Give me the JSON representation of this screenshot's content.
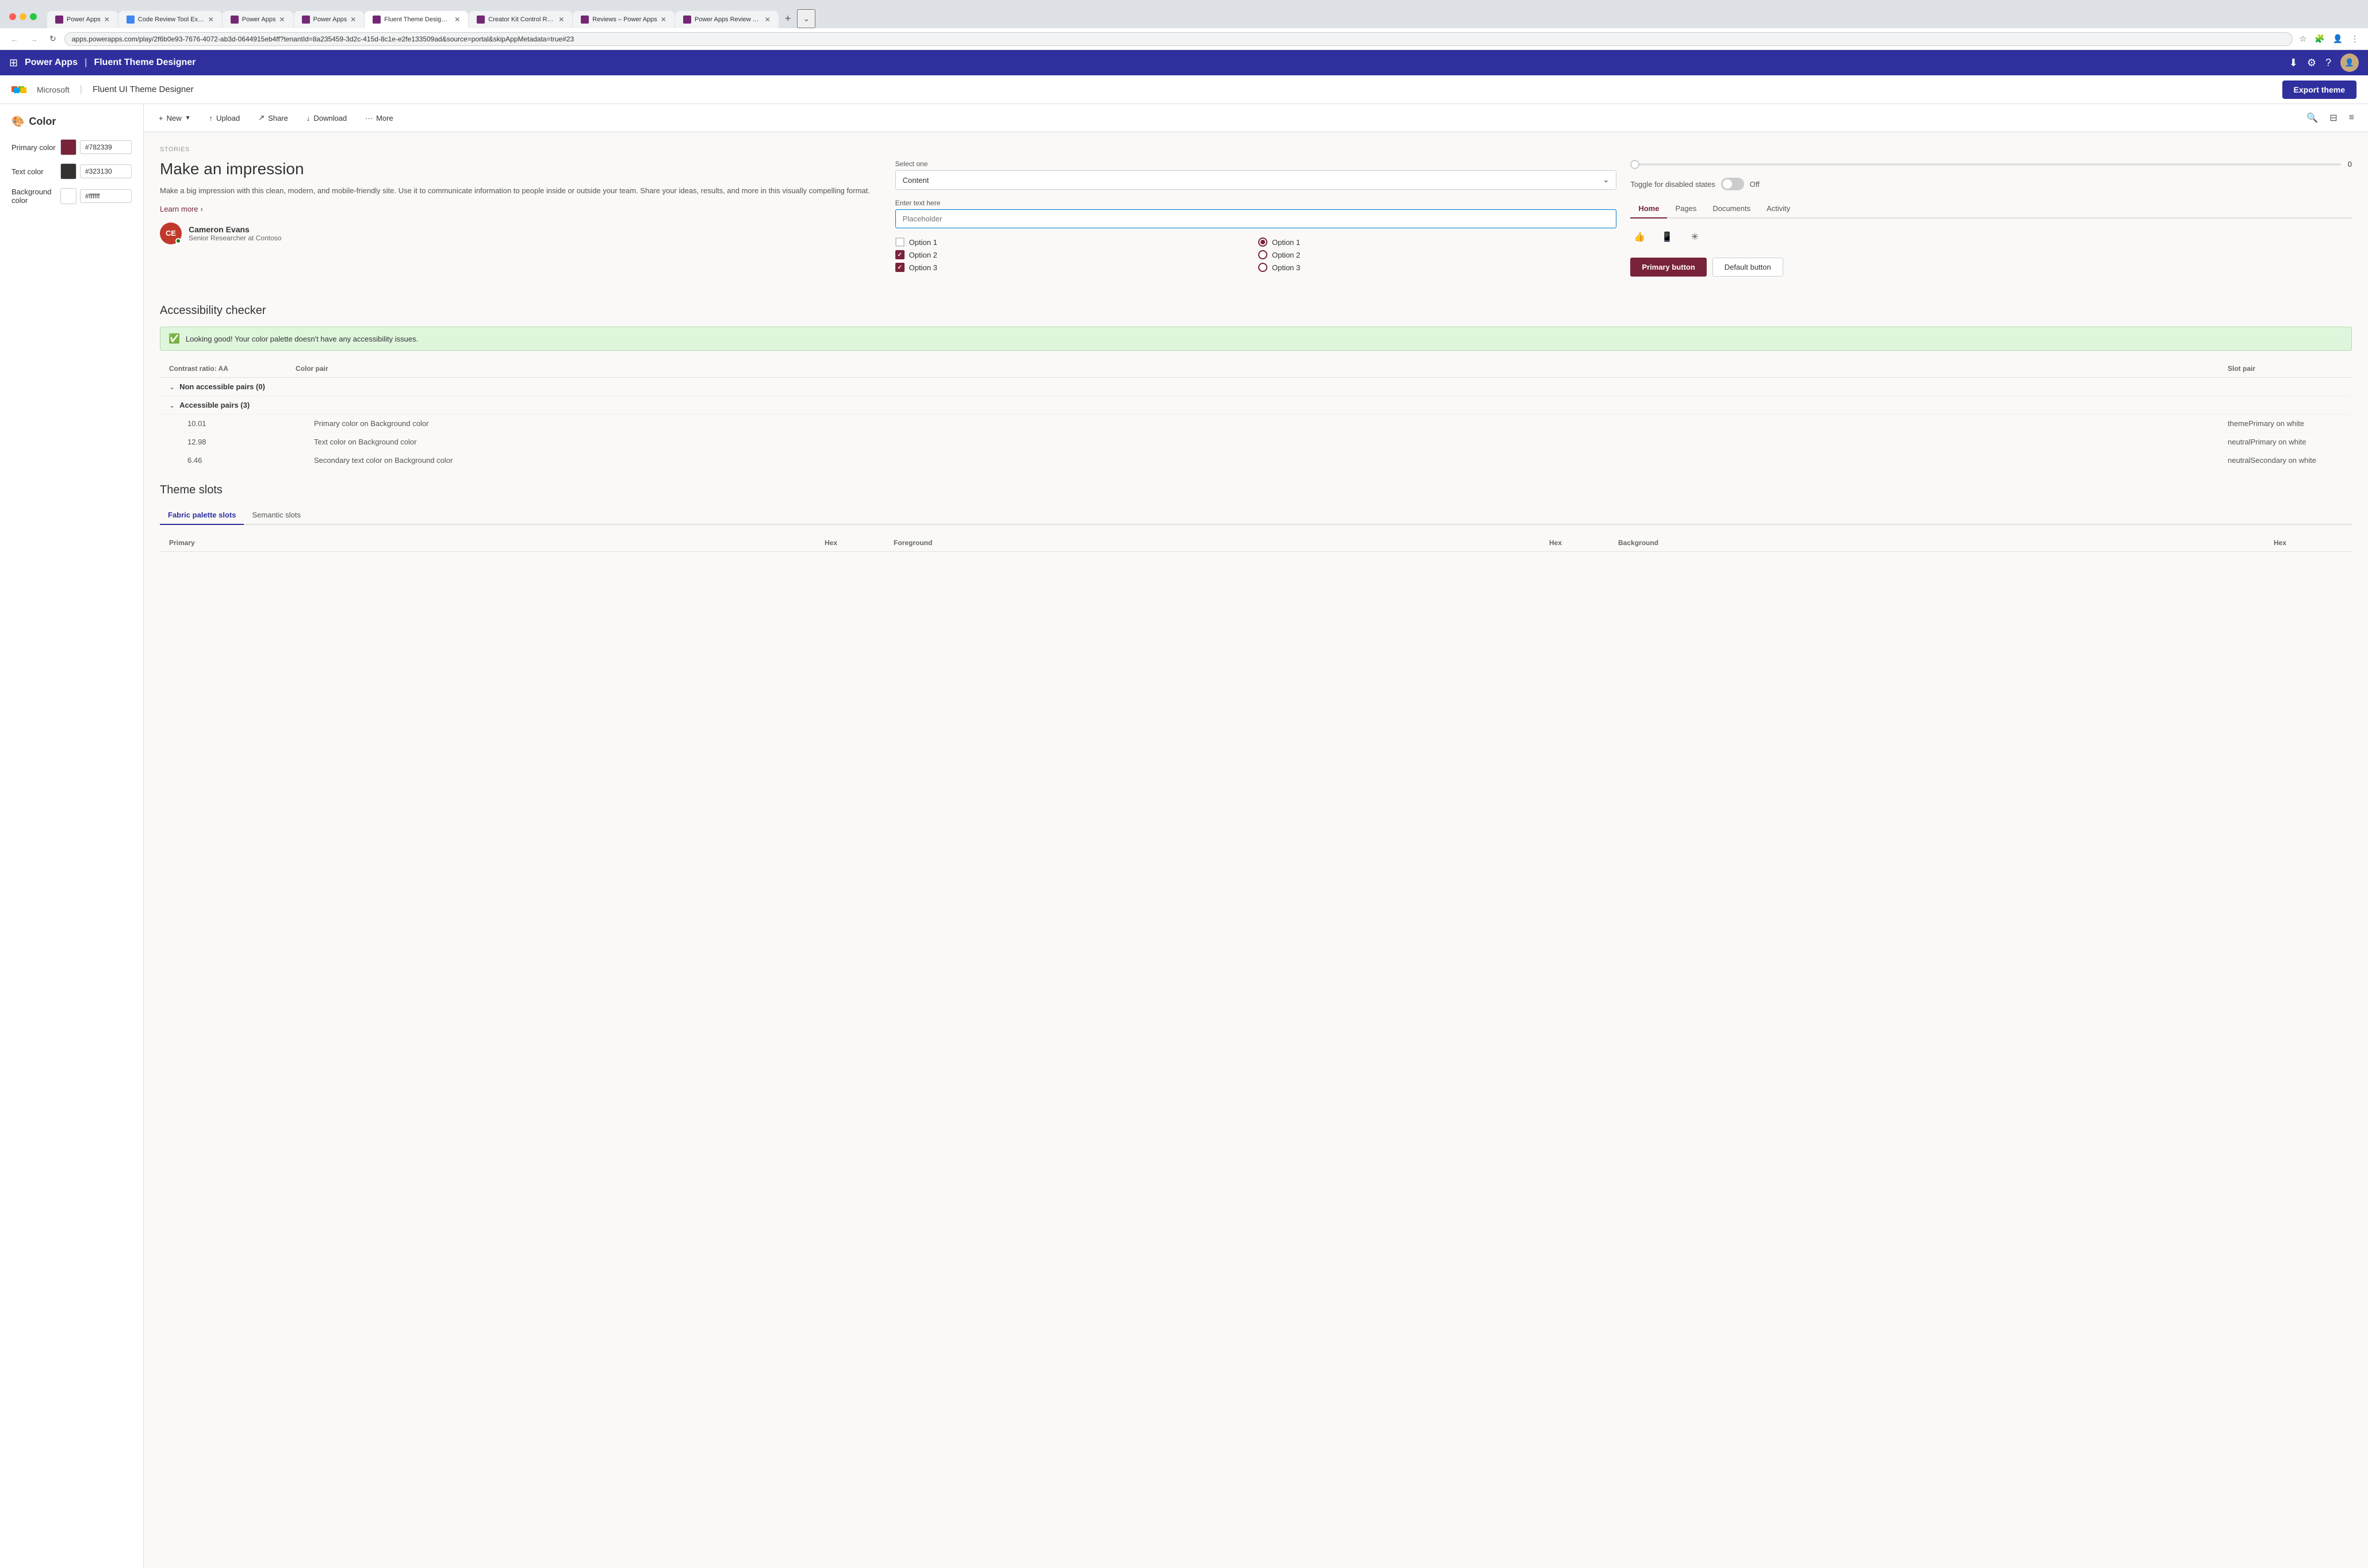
{
  "browser": {
    "tabs": [
      {
        "id": "t1",
        "label": "Power Apps",
        "favicon": "pa",
        "active": false
      },
      {
        "id": "t2",
        "label": "Code Review Tool Experim...",
        "favicon": "cr",
        "active": false
      },
      {
        "id": "t3",
        "label": "Power Apps",
        "favicon": "pa",
        "active": false
      },
      {
        "id": "t4",
        "label": "Power Apps",
        "favicon": "pa",
        "active": false
      },
      {
        "id": "t5",
        "label": "Fluent Theme Designer - ...",
        "favicon": "ft",
        "active": true
      },
      {
        "id": "t6",
        "label": "Creator Kit Control Refere...",
        "favicon": "pa",
        "active": false
      },
      {
        "id": "t7",
        "label": "Reviews – Power Apps",
        "favicon": "pa",
        "active": false
      },
      {
        "id": "t8",
        "label": "Power Apps Review Tool -...",
        "favicon": "pa",
        "active": false
      }
    ],
    "url": "apps.powerapps.com/play/2f6b0e93-7676-4072-ab3d-0644915eb4ff?tenantId=8a235459-3d2c-415d-8c1e-e2fe133509ad&source=portal&skipAppMetadata=true#23",
    "add_tab_label": "+",
    "chevron_label": "⌄"
  },
  "app_header": {
    "grid_icon": "⊞",
    "brand": "Power Apps",
    "separator": "|",
    "app_name": "Fluent Theme Designer",
    "icons": {
      "download": "⬇",
      "settings": "⚙",
      "help": "?"
    },
    "avatar_initials": "👤"
  },
  "tool_header": {
    "ms_label": "Microsoft",
    "separator": "|",
    "tool_name": "Fluent UI Theme Designer",
    "export_button": "Export theme"
  },
  "sidebar": {
    "title": "Color",
    "title_icon": "🎨",
    "colors": [
      {
        "id": "primary",
        "label": "Primary color",
        "hex": "#782339",
        "swatch_color": "#782339"
      },
      {
        "id": "text",
        "label": "Text color",
        "hex": "#323130",
        "swatch_color": "#323130"
      },
      {
        "id": "background",
        "label": "Background color",
        "hex": "#ffffff",
        "swatch_color": "#ffffff"
      }
    ]
  },
  "toolbar": {
    "new_icon": "+",
    "new_label": "New",
    "upload_icon": "↑",
    "upload_label": "Upload",
    "share_icon": "↗",
    "share_label": "Share",
    "download_icon": "↓",
    "download_label": "Download",
    "more_icon": "···",
    "more_label": "More",
    "search_icon": "🔍",
    "filter_icon": "⊟",
    "grid_icon": "≡"
  },
  "preview": {
    "stories_label": "STORIES",
    "title": "Make an impression",
    "description": "Make a big impression with this clean, modern, and mobile-friendly site. Use it to communicate information to people inside or outside your team. Share your ideas, results, and more in this visually compelling format.",
    "learn_more": "Learn more",
    "user": {
      "initials": "CE",
      "name": "Cameron Evans",
      "title": "Senior Researcher at Contoso"
    },
    "select": {
      "label": "Select one",
      "value": "Content",
      "placeholder": "Content"
    },
    "text_input": {
      "label": "Enter text here",
      "placeholder": "Placeholder"
    },
    "checkboxes": [
      {
        "id": "cb1",
        "label": "Option 1",
        "checked": false
      },
      {
        "id": "cb2",
        "label": "Option 2",
        "checked": true
      },
      {
        "id": "cb3",
        "label": "Option 3",
        "checked": true
      }
    ],
    "radios": [
      {
        "id": "r1",
        "label": "Option 1",
        "checked": true
      },
      {
        "id": "r2",
        "label": "Option 2",
        "checked": false
      },
      {
        "id": "r3",
        "label": "Option 3",
        "checked": false
      }
    ],
    "slider": {
      "value": 0,
      "min": 0,
      "max": 100
    },
    "toggle": {
      "label": "Toggle for disabled states",
      "state": "Off"
    },
    "nav_tabs": [
      {
        "id": "home",
        "label": "Home",
        "active": true
      },
      {
        "id": "pages",
        "label": "Pages",
        "active": false
      },
      {
        "id": "documents",
        "label": "Documents",
        "active": false
      },
      {
        "id": "activity",
        "label": "Activity",
        "active": false
      }
    ],
    "buttons": {
      "primary": "Primary button",
      "default": "Default button"
    }
  },
  "accessibility": {
    "title": "Accessibility checker",
    "success_message": "Looking good! Your color palette doesn't have any accessibility issues.",
    "table_headers": {
      "contrast": "Contrast ratio: AA",
      "color_pair": "Color pair",
      "slot_pair": "Slot pair"
    },
    "non_accessible": {
      "label": "Non accessible pairs (0)",
      "count": 0
    },
    "accessible": {
      "label": "Accessible pairs (3)",
      "count": 3,
      "rows": [
        {
          "ratio": "10.01",
          "color_pair": "Primary color on Background color",
          "slot_pair": "themePrimary on white"
        },
        {
          "ratio": "12.98",
          "color_pair": "Text color on Background color",
          "slot_pair": "neutralPrimary on white"
        },
        {
          "ratio": "6.46",
          "color_pair": "Secondary text color on Background color",
          "slot_pair": "neutralSecondary on white"
        }
      ]
    }
  },
  "theme_slots": {
    "title": "Theme slots",
    "tabs": [
      {
        "id": "fabric",
        "label": "Fabric palette slots",
        "active": true
      },
      {
        "id": "semantic",
        "label": "Semantic slots",
        "active": false
      }
    ],
    "table_headers": [
      "Primary",
      "Hex",
      "Foreground",
      "Hex",
      "Background",
      "Hex"
    ]
  }
}
